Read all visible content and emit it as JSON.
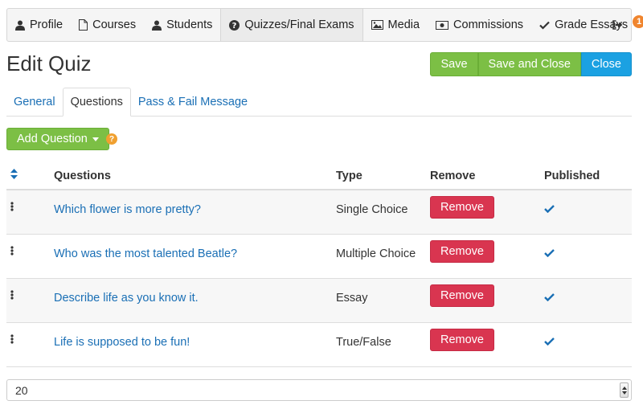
{
  "nav": {
    "items": [
      {
        "label": "Profile",
        "icon": "user-icon"
      },
      {
        "label": "Courses",
        "icon": "file-icon"
      },
      {
        "label": "Students",
        "icon": "user-icon"
      },
      {
        "label": "Quizzes/Final Exams",
        "icon": "question-circle-icon"
      },
      {
        "label": "Media",
        "icon": "image-icon"
      },
      {
        "label": "Commissions",
        "icon": "money-icon"
      },
      {
        "label": "Grade Essays",
        "icon": "check-icon",
        "badge": "1"
      }
    ],
    "active_index": 3,
    "logout_icon": "sign-out-icon"
  },
  "page": {
    "title": "Edit Quiz"
  },
  "actions": {
    "save": "Save",
    "save_close": "Save and Close",
    "close": "Close"
  },
  "tabs": [
    {
      "label": "General"
    },
    {
      "label": "Questions",
      "active": true
    },
    {
      "label": "Pass & Fail Message"
    }
  ],
  "add_question": {
    "label": "Add Question",
    "help": "?"
  },
  "table": {
    "headers": {
      "questions": "Questions",
      "type": "Type",
      "remove": "Remove",
      "published": "Published"
    },
    "rows": [
      {
        "question": "Which flower is more pretty?",
        "type": "Single Choice",
        "remove": "Remove",
        "published": true
      },
      {
        "question": "Who was the most talented Beatle?",
        "type": "Multiple Choice",
        "remove": "Remove",
        "published": true
      },
      {
        "question": "Describe life as you know it.",
        "type": "Essay",
        "remove": "Remove",
        "published": true
      },
      {
        "question": "Life is supposed to be fun!",
        "type": "True/False",
        "remove": "Remove",
        "published": true
      }
    ]
  },
  "page_size": {
    "value": "20"
  },
  "colors": {
    "green": "#7cbf45",
    "blue": "#1ba1e2",
    "red": "#d93550",
    "link": "#1a6fb5",
    "badge": "#f0852e"
  }
}
